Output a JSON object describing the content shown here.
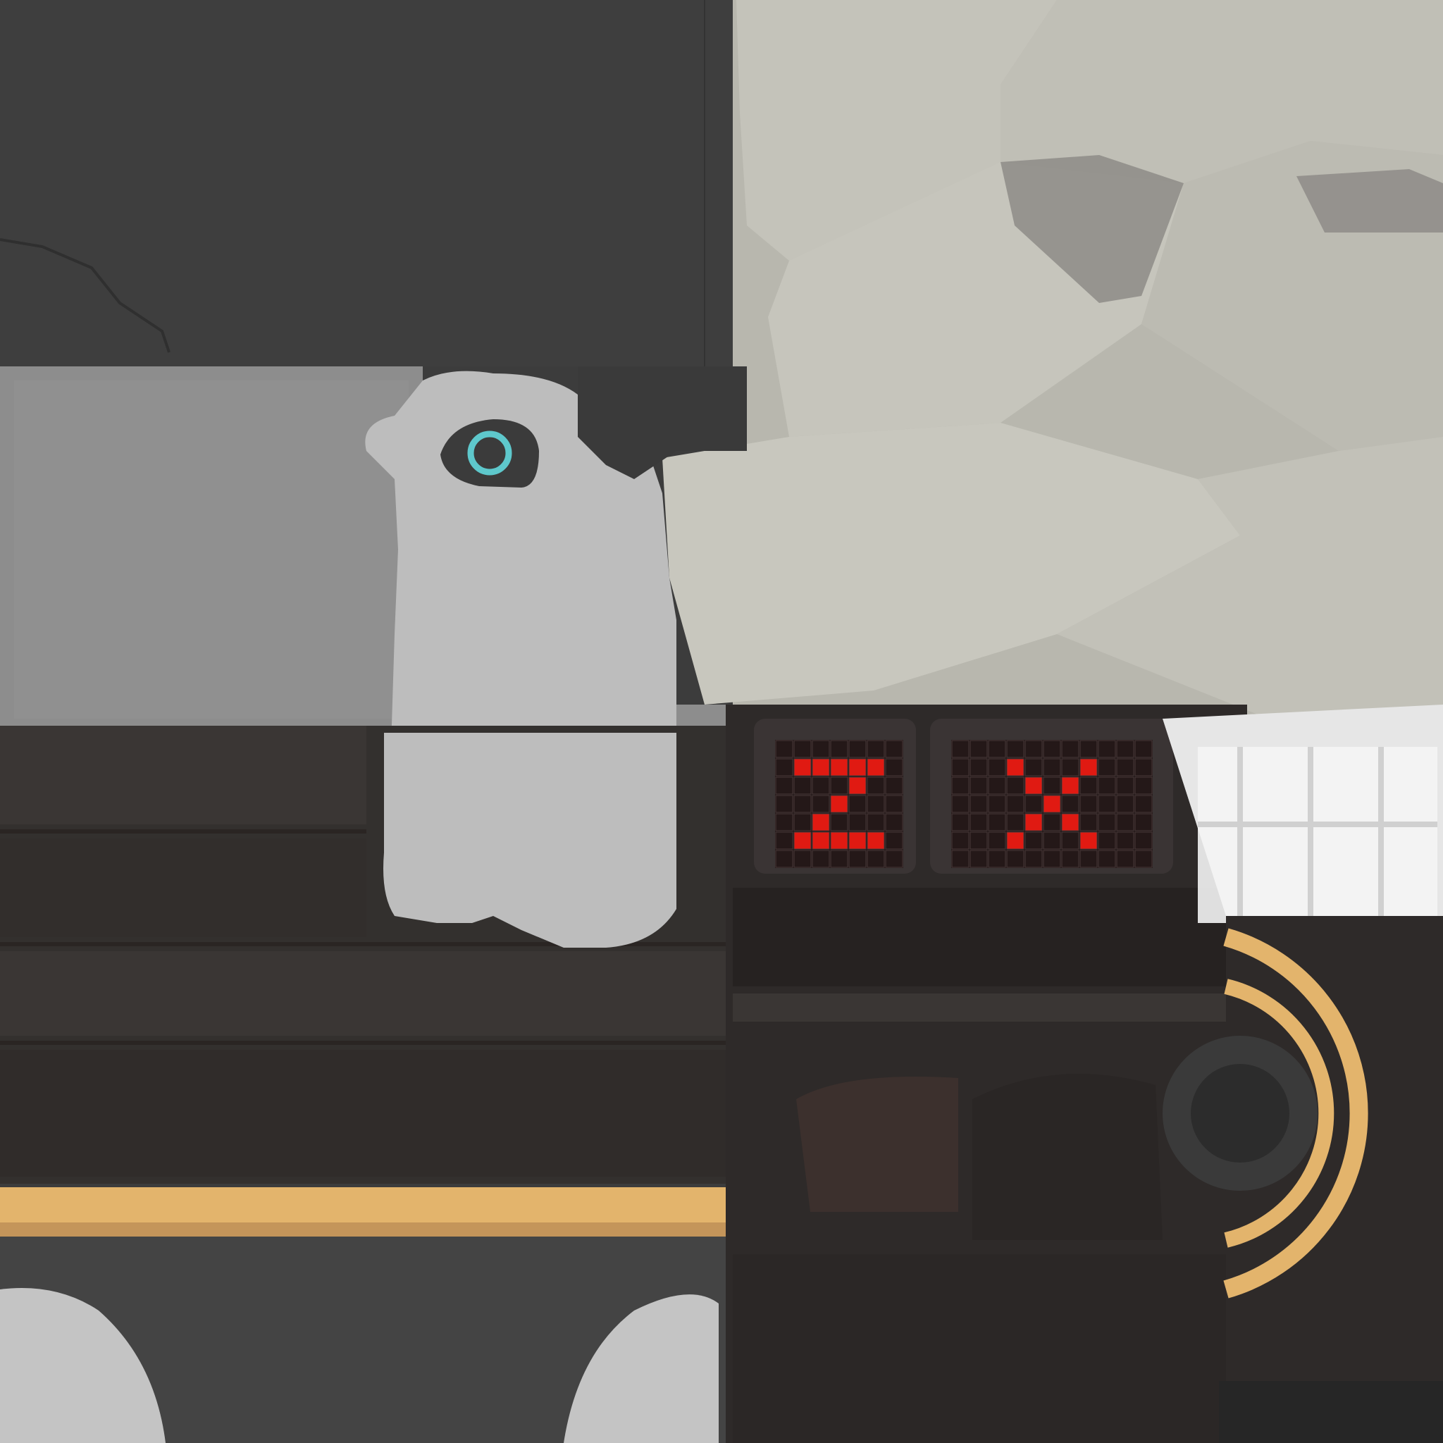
{
  "texture": {
    "description_free": true,
    "colors": {
      "dark_metal": "#3c3c3c",
      "concrete": "#8e8e8e",
      "stone_light": "#c6c5bd",
      "stone_shadow": "#8f8d88",
      "robot_body": "#bdbdbd",
      "wood_dark": "#2f2a28",
      "trim_gold": "#e3b46c",
      "eye_ring": "#5ec8cc",
      "led_red": "#e01a12",
      "led_grid": "#4a3a3a",
      "window_white": "#efefef"
    }
  },
  "display": {
    "left_char": "Z",
    "right_char": "X"
  },
  "icons": {
    "eye": "eye-icon",
    "window": "window-icon",
    "dial": "dial-icon"
  }
}
